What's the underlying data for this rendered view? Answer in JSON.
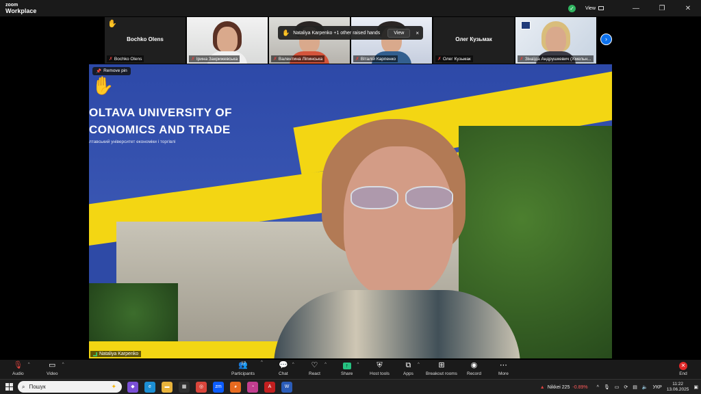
{
  "app": {
    "logo_line1": "zoom",
    "logo_line2": "Workplace",
    "view_label": "View"
  },
  "window_controls": {
    "minimize": "—",
    "maximize": "❐",
    "close": "✕"
  },
  "filmstrip": [
    {
      "name": "Bochko Olens",
      "center_name": "Bochko Olens",
      "raised_hand": true
    },
    {
      "name": "Ірина Закрижевська"
    },
    {
      "name": "Валентина Ліпинська"
    },
    {
      "name": "Віталій Карпенко"
    },
    {
      "name": "Олег Кузьмак",
      "center_name": "Олег Кузьмак"
    },
    {
      "name": "Зінаїда Андрушкевич (Хмельн..."
    }
  ],
  "raised_notice": {
    "text": "Nataliya Karpenko +1 other raised hands",
    "view_button": "View",
    "close": "×"
  },
  "main_video": {
    "remove_pin": "Remove pin",
    "title_line1": "OLTAVA UNIVERSITY OF",
    "title_line2": "CONOMICS AND TRADE",
    "subtitle": "лтавський університет економіки і торгівлі",
    "participant": "Nataliya Karpenko"
  },
  "toolbar": {
    "audio": "Audio",
    "video": "Video",
    "participants": "Participants",
    "participants_count": "37",
    "chat": "Chat",
    "react": "React",
    "share": "Share",
    "host_tools": "Host tools",
    "apps": "Apps",
    "breakout": "Breakout rooms",
    "record": "Record",
    "more": "More",
    "end": "End"
  },
  "taskbar": {
    "search_placeholder": "Пошук",
    "stock_name": "Nikkei 225",
    "stock_change": "-0.89%",
    "language": "УКР",
    "time": "11:22",
    "date": "13.06.2025"
  },
  "colors": {
    "accent": "#0e72ed",
    "share_green": "#26c281",
    "end_red": "#e02828",
    "banner_yellow": "#f3d613",
    "banner_blue": "#2d49a8"
  }
}
